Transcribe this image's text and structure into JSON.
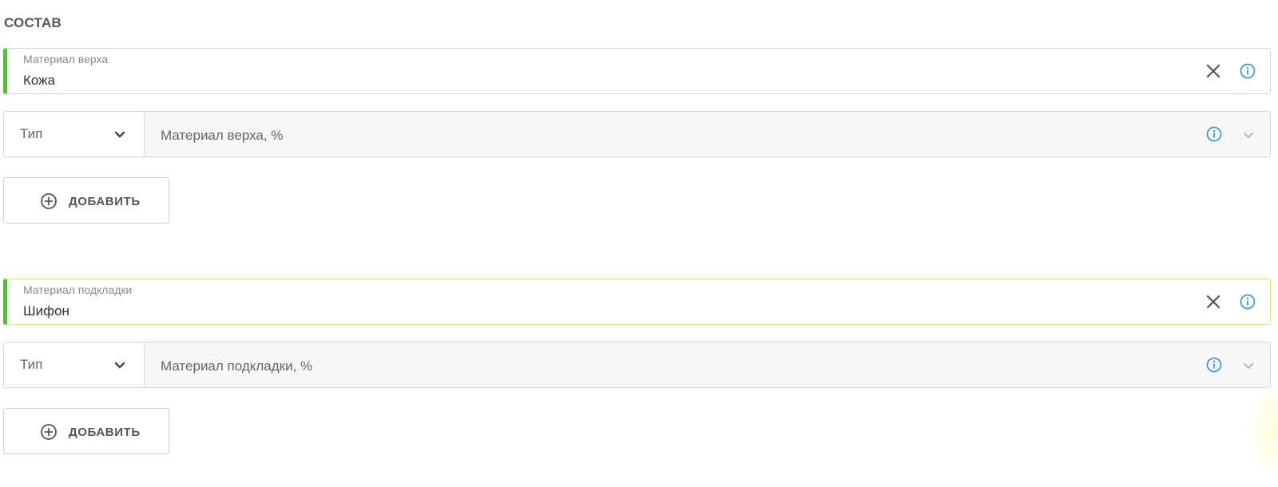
{
  "section": {
    "title": "СОСТАВ"
  },
  "groups": [
    {
      "material": {
        "label": "Материал верха",
        "value": "Кожа"
      },
      "composition": {
        "type_label": "Тип",
        "percent_placeholder": "Материал верха, %"
      },
      "add_button": {
        "label": "ДОБАВИТЬ"
      }
    },
    {
      "material": {
        "label": "Материал подкладки",
        "value": "Шифон"
      },
      "composition": {
        "type_label": "Тип",
        "percent_placeholder": "Материал подкладки, %"
      },
      "add_button": {
        "label": "ДОБАВИТЬ"
      }
    }
  ],
  "icons": {
    "clear": "close-icon",
    "info": "info-icon",
    "dropdown": "chevron-down-icon",
    "add": "plus-circle-icon"
  },
  "colors": {
    "valid_accent": "#4cc531",
    "info_blue": "#3a9ad9",
    "focus_border": "#e8ec3a"
  }
}
